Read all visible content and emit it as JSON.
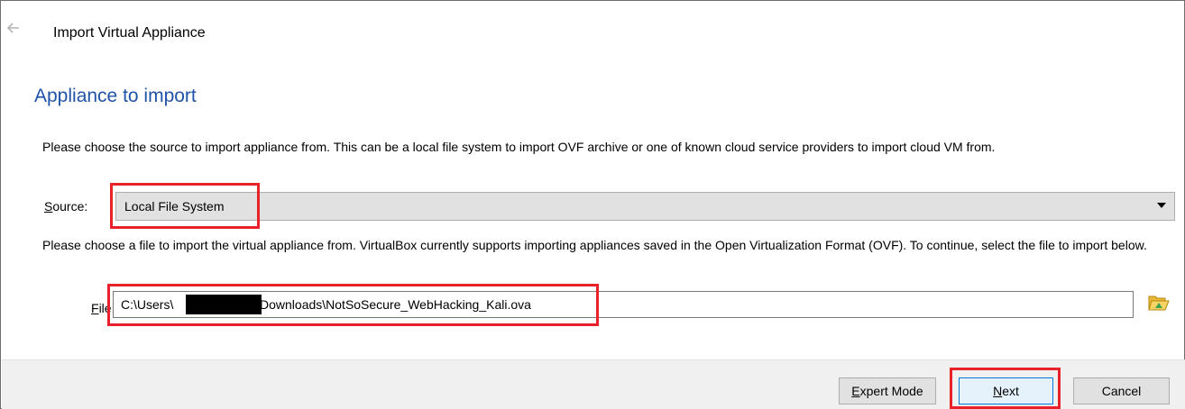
{
  "window": {
    "title": "Import Virtual Appliance",
    "back_icon": "arrow-left-icon"
  },
  "page": {
    "heading": "Appliance to import",
    "source_description": "Please choose the source to import appliance from. This can be a local file system to import OVF archive or one of known cloud service providers to import cloud VM from.",
    "file_description": "Please choose a file to import the virtual appliance from. VirtualBox currently supports importing appliances saved in the Open Virtualization Format (OVF). To continue, select the file to import below."
  },
  "source": {
    "label_access_key": "S",
    "label_rest": "ource:",
    "value": "Local File System"
  },
  "file": {
    "label_access_key": "F",
    "label_rest": "ile:",
    "value_prefix": "C:\\Users\\",
    "value_suffix": "Downloads\\NotSoSecure_WebHacking_Kali.ova",
    "browse_icon": "folder-open-icon"
  },
  "buttons": {
    "expert_access_key": "E",
    "expert_rest": "xpert Mode",
    "next_access_key": "N",
    "next_rest": "ext",
    "cancel": "Cancel"
  },
  "colors": {
    "heading": "#1f53a8",
    "highlight": "#e8212b",
    "footer_bg": "#f0f0f0"
  }
}
